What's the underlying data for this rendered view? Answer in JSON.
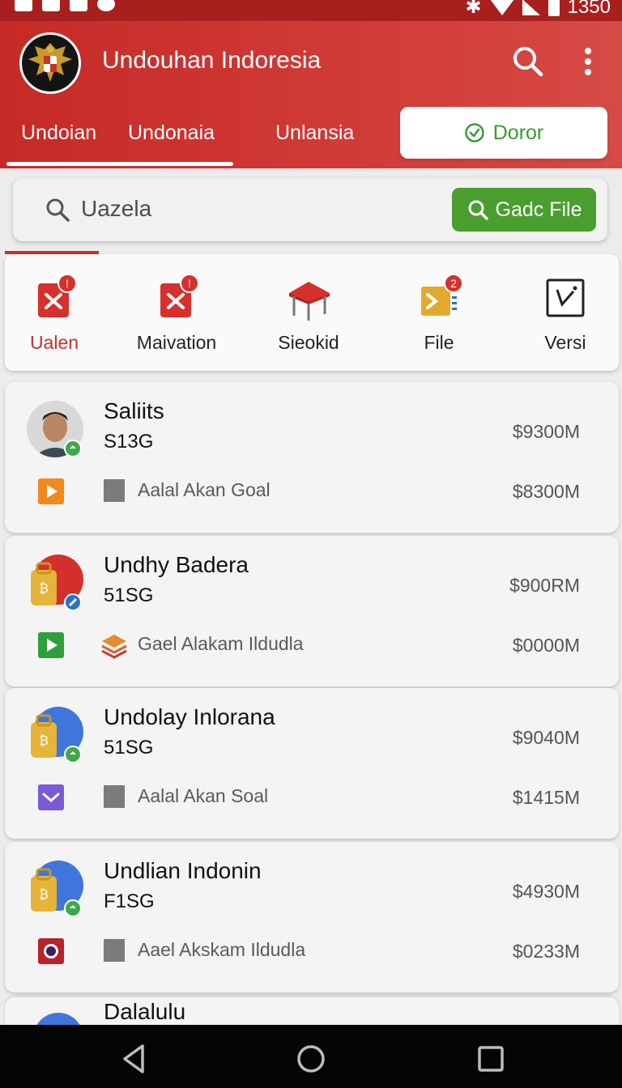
{
  "status_bar": {
    "time": "1350"
  },
  "header": {
    "title": "Undouhan Indoresia"
  },
  "tabs": {
    "items": [
      "Undoian",
      "Undonaia",
      "Unlansia"
    ],
    "pill_label": "Doror"
  },
  "search": {
    "placeholder": "Uazela",
    "button_label": "Gadc File"
  },
  "categories": [
    {
      "label": "Ualen",
      "badge": "!"
    },
    {
      "label": "Maivation",
      "badge": "!"
    },
    {
      "label": "Sieokid",
      "badge": ""
    },
    {
      "label": "File",
      "badge": "2"
    },
    {
      "label": "Versi",
      "badge": ""
    }
  ],
  "results": [
    {
      "name": "Saliits",
      "code": "S13G",
      "amount_top": "$9300M",
      "desc": "Aalal Akan Goal",
      "amount_bottom": "$8300M"
    },
    {
      "name": "Undhy Badera",
      "code": "51SG",
      "amount_top": "$900RM",
      "desc": "Gael Alakam Ildudla",
      "amount_bottom": "$0000M"
    },
    {
      "name": "Undolay Inlorana",
      "code": "51SG",
      "amount_top": "$9040M",
      "desc": "Aalal Akan Soal",
      "amount_bottom": "$1415M"
    },
    {
      "name": "Undlian Indonin",
      "code": "F1SG",
      "amount_top": "$4930M",
      "desc": "Aael Akskam Ildudla",
      "amount_bottom": "$0233M"
    }
  ],
  "partial_item": {
    "name": "Dalalulu"
  },
  "colors": {
    "primary": "#c52a27",
    "accent_green": "#4a9e2f",
    "background": "#ececec"
  }
}
